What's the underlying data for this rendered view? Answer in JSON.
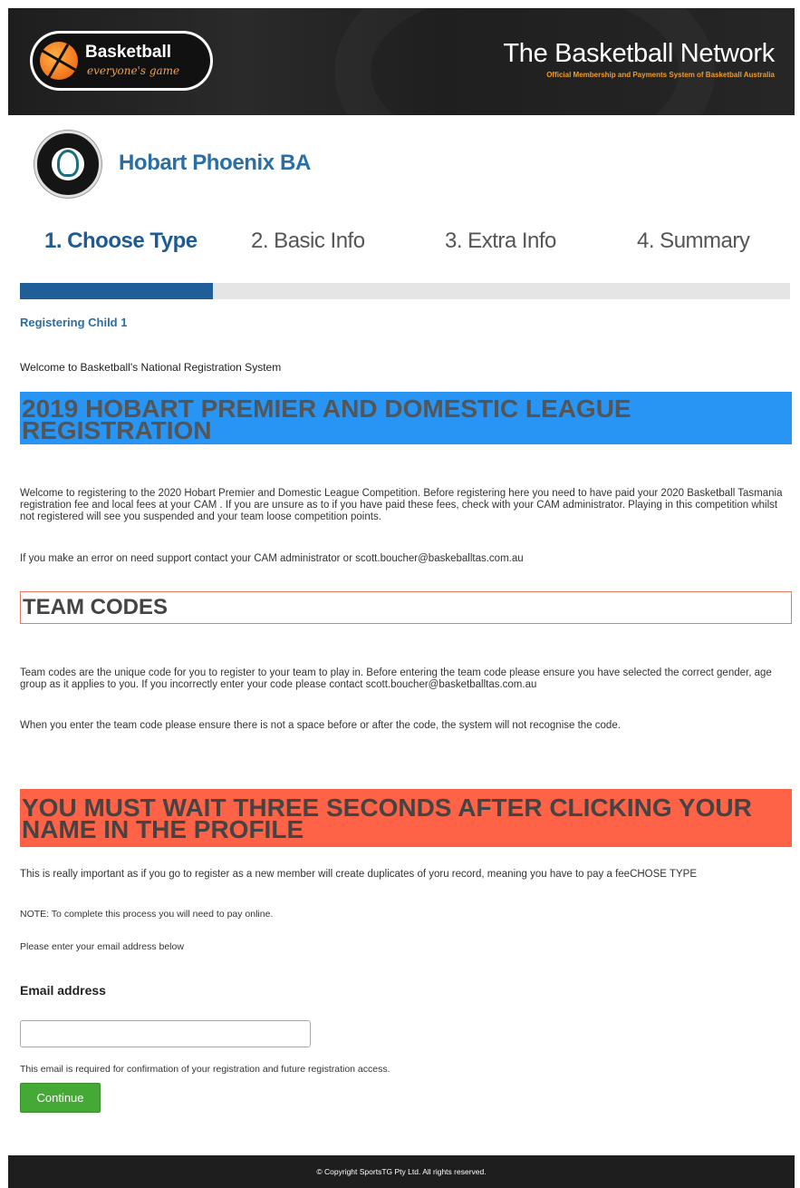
{
  "header": {
    "logo_word": "Basketball",
    "logo_tagline": "everyone's game",
    "network_title": "The Basketball Network",
    "network_subtitle": "Official Membership and Payments System of Basketball Australia"
  },
  "club": {
    "name": "Hobart Phoenix BA"
  },
  "steps": [
    {
      "label": "1. Choose Type",
      "active": true
    },
    {
      "label": "2. Basic Info",
      "active": false
    },
    {
      "label": "3. Extra Info",
      "active": false
    },
    {
      "label": "4. Summary",
      "active": false
    }
  ],
  "progress": 0.25,
  "content": {
    "registering": "Registering Child 1",
    "welcome": "Welcome to Basketball's National Registration System",
    "banner_blue": "2019 HOBART PREMIER AND DOMESTIC LEAGUE REGISTRATION",
    "intro_para": "Welcome to registering to the 2020 Hobart Premier and Domestic League Competition. Before registering here you need to have paid your 2020 Basketball Tasmania registration fee and local fees at your CAM . If you are unsure as to if you have paid these fees, check with your CAM administrator. Playing in this competition whilst not registered will see you suspended and your team loose competition points.",
    "support_para": "If you make an error on need support contact your CAM administrator or scott.boucher@baskeballtas.com.au",
    "team_codes_title": "TEAM CODES",
    "team_codes_para": "Team codes are the unique code for you to register to your team to play in. Before entering the team code please ensure you have selected the correct gender, age group as it applies to you. If you incorrectly enter your code please contact scott.boucher@basketballtas.com.au",
    "team_codes_para2": "When you enter the team code please ensure there is not a space before or after the code, the system will not recognise the code.",
    "banner_red": "YOU MUST WAIT THREE SECONDS AFTER CLICKING YOUR NAME IN THE PROFILE",
    "important_para": "This is really important as if you go to register as a new member will create duplicates of yoru record, meaning you have to pay a feeCHOSE TYPE",
    "note": "NOTE: To complete this process you will need to pay online.",
    "email_prompt": "Please enter your email address below",
    "email_label": "Email address",
    "email_value": "",
    "email_help": "This email is required for confirmation of your registration and future registration access.",
    "continue_label": "Continue"
  },
  "footer": {
    "copyright": "©  Copyright SportsTG Pty Ltd. All rights reserved."
  },
  "colors": {
    "accent_blue": "#1f5e96",
    "banner_blue": "#2895f4",
    "banner_red": "#fe6347",
    "button_green": "#45a935"
  }
}
